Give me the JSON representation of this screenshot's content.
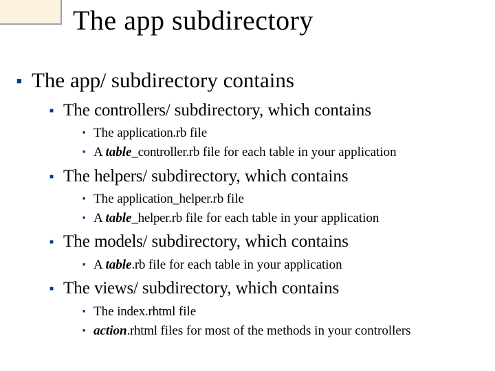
{
  "title": "The app subdirectory",
  "l0": {
    "prefix": "The ",
    "code": "app/",
    "suffix": " subdirectory contains"
  },
  "sections": [
    {
      "prefix": "The ",
      "code": "controllers/",
      "suffix": " subdirectory, which contains",
      "items": [
        {
          "t1": "The ",
          "c1": "application.rb",
          "t2": " file"
        },
        {
          "t1": "A ",
          "i1": "table",
          "c1": "_controller.rb",
          "t2": " file for each table in your application"
        }
      ]
    },
    {
      "prefix": "The ",
      "code": "helpers/",
      "suffix": " subdirectory, which contains",
      "items": [
        {
          "t1": "The ",
          "c1": "application_helper.rb",
          "t2": " file"
        },
        {
          "t1": "A ",
          "i1": "table",
          "c1": "_helper.rb",
          "t2": " file for each table in your application"
        }
      ]
    },
    {
      "prefix": "The ",
      "code": "models/",
      "suffix": " subdirectory, which contains",
      "items": [
        {
          "t1": "A ",
          "i1": "table",
          "c1": ".rb",
          "t2": " file for each table in your application"
        }
      ]
    },
    {
      "prefix": "The ",
      "code": "views/",
      "suffix": " subdirectory, which contains",
      "items": [
        {
          "t1": "The ",
          "c1": "index.rhtml",
          "t2": " file"
        },
        {
          "i1": "action",
          "c1": ".rhtml",
          "t2": " files for most of the methods in your controllers"
        }
      ]
    }
  ]
}
